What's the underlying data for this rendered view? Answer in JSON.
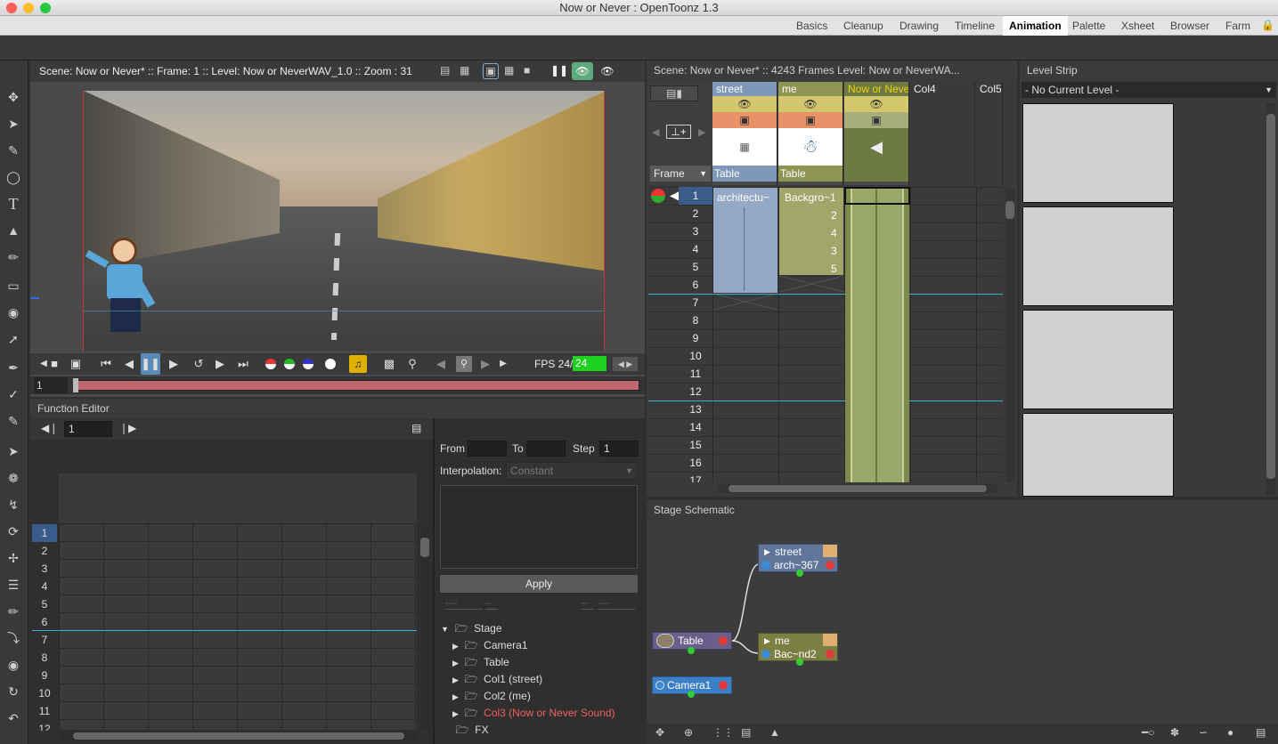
{
  "app": {
    "title": "Now or Never : OpenToonz 1.3"
  },
  "rooms": [
    "Basics",
    "Cleanup",
    "Drawing",
    "Timeline",
    "Animation",
    "Palette",
    "Xsheet",
    "Browser",
    "Farm"
  ],
  "active_room": "Animation",
  "viewer": {
    "header": "Scene: Now or Never*  ::  Frame: 1  ::  Level: Now or NeverWAV_1.0  ::  Zoom : 31",
    "fps_label": "FPS 24/",
    "fps_value": "24",
    "frame_field": "1"
  },
  "function_editor": {
    "title": "Function Editor",
    "frame_field": "1",
    "rows": [
      "1",
      "2",
      "3",
      "4",
      "5",
      "6",
      "7",
      "8",
      "9",
      "10",
      "11",
      "12"
    ],
    "from_label": "From",
    "to_label": "To",
    "step_label": "Step",
    "step_value": "1",
    "interp_label": "Interpolation:",
    "interp_value": "Constant",
    "apply_label": "Apply",
    "placeholder_a": "----",
    "placeholder_b": "--",
    "placeholder_c": "--",
    "placeholder_d": "----",
    "tree": [
      "Stage",
      "Camera1",
      "Table",
      "Col1 (street)",
      "Col2 (me)",
      "Col3 (Now or Never Sound)",
      "FX"
    ]
  },
  "xsheet": {
    "header": "Scene: Now or Never*  ::  4243 Frames  Level: Now or NeverWA...",
    "frame_dropdown": "Frame",
    "columns": [
      {
        "name": "street",
        "pegbar": "Table",
        "cell1": "architectu~"
      },
      {
        "name": "me",
        "pegbar": "Table",
        "cell1": "Backgro~1"
      },
      {
        "name": "Now or Neve",
        "pegbar": "",
        "cell1": ""
      },
      {
        "name": "Col4",
        "pegbar": "",
        "cell1": ""
      },
      {
        "name": "Col5",
        "pegbar": "",
        "cell1": ""
      }
    ],
    "me_values": [
      "2",
      "4",
      "3",
      "5"
    ],
    "frames": [
      "1",
      "2",
      "3",
      "4",
      "5",
      "6",
      "7",
      "8",
      "9",
      "10",
      "11",
      "12",
      "13",
      "14",
      "15",
      "16",
      "17"
    ]
  },
  "level_strip": {
    "title": "Level Strip",
    "current": "- No Current Level -"
  },
  "schematic": {
    "title": "Stage Schematic",
    "nodes": {
      "street": "street",
      "street_sub": "arch~367",
      "me": "me",
      "me_sub": "Bac~nd2",
      "table": "Table",
      "camera": "Camera1"
    }
  },
  "colors": {
    "street_col": "#7f97b8",
    "me_col": "#8e9553",
    "sound_col": "#6d7a44",
    "fps_green": "#1fd11f",
    "accent_yellow": "#f0d000"
  }
}
